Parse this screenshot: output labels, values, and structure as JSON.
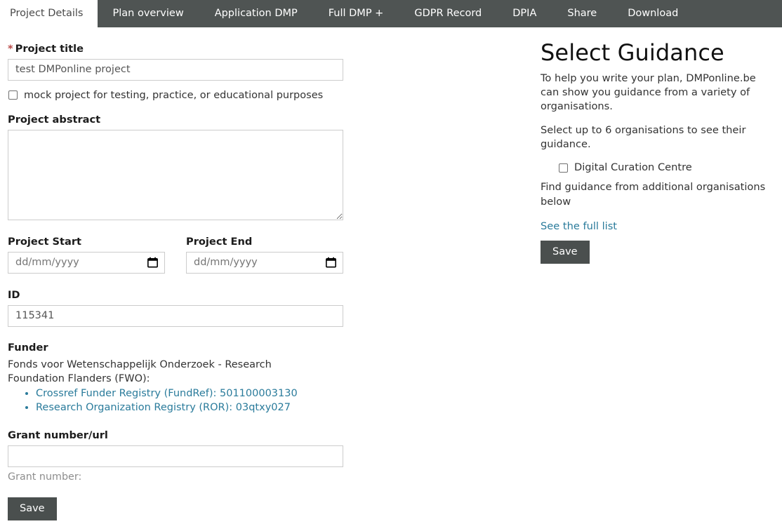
{
  "tabs": [
    {
      "label": "Project Details",
      "active": true
    },
    {
      "label": "Plan overview",
      "active": false
    },
    {
      "label": "Application DMP",
      "active": false
    },
    {
      "label": "Full DMP +",
      "active": false
    },
    {
      "label": "GDPR Record",
      "active": false
    },
    {
      "label": "DPIA",
      "active": false
    },
    {
      "label": "Share",
      "active": false
    },
    {
      "label": "Download",
      "active": false
    }
  ],
  "form": {
    "required_marker": "*",
    "project_title": {
      "label": "Project title",
      "value": "test DMPonline project",
      "placeholder": ""
    },
    "mock_project": {
      "label": "mock project for testing, practice, or educational purposes",
      "checked": false
    },
    "project_abstract": {
      "label": "Project abstract",
      "value": "",
      "placeholder": ""
    },
    "project_start": {
      "label": "Project Start",
      "value": "",
      "placeholder": "dd/mm/yyyy"
    },
    "project_end": {
      "label": "Project End",
      "value": "",
      "placeholder": "dd/mm/yyyy"
    },
    "id": {
      "label": "ID",
      "value": "115341",
      "placeholder": ""
    },
    "funder": {
      "label": "Funder",
      "name": "Fonds voor Wetenschappelijk Onderzoek - Research Foundation Flanders (FWO):",
      "registries": [
        "Crossref Funder Registry (FundRef): 501100003130",
        "Research Organization Registry (ROR): 03qtxy027"
      ]
    },
    "grant_number": {
      "label": "Grant number/url",
      "value": "",
      "placeholder": "",
      "hint": "Grant number:"
    },
    "save_label": "Save"
  },
  "guidance": {
    "title": "Select Guidance",
    "intro": "To help you write your plan, DMPonline.be can show you guidance from a variety of organisations.",
    "instruction": "Select up to 6 organisations to see their guidance.",
    "organisations": [
      {
        "label": "Digital Curation Centre",
        "checked": false
      }
    ],
    "additional_text": "Find guidance from additional organisations below",
    "full_list_link": "See the full list",
    "save_label": "Save"
  },
  "colors": {
    "tabbar_bg": "#4f5453",
    "active_tab_bg": "#ffffff",
    "button_bg": "#4a4f4e",
    "link": "#2a7b9b",
    "required_star": "#b94a48",
    "input_border": "#cccccc"
  }
}
